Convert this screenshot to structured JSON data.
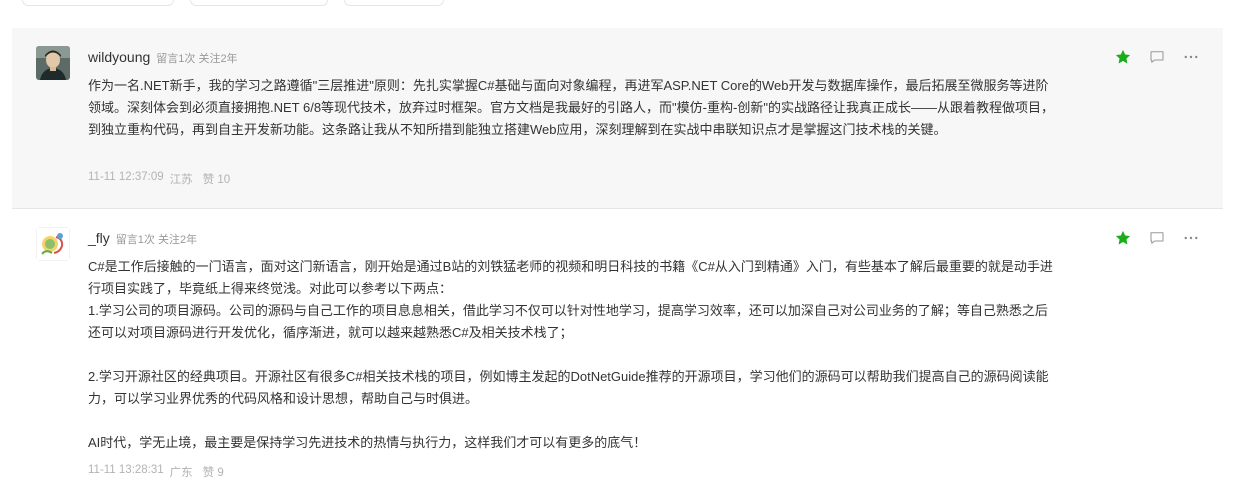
{
  "colors": {
    "accent": "#1aad19",
    "muted": "#999999",
    "card_bg": "#f7f7f7"
  },
  "comments": [
    {
      "username": "wildyoung",
      "stats": "留言1次 关注2年",
      "paragraphs": [
        "作为一名.NET新手，我的学习之路遵循\"三层推进\"原则：先扎实掌握C#基础与面向对象编程，再进军ASP.NET Core的Web开发与数据库操作，最后拓展至微服务等进阶领域。深刻体会到必须直接拥抱.NET 6/8等现代技术，放弃过时框架。官方文档是我最好的引路人，而\"模仿-重构-创新\"的实战路径让我真正成长——从跟着教程做项目，到独立重构代码，再到自主开发新功能。这条路让我从不知所措到能独立搭建Web应用，深刻理解到在实战中串联知识点才是掌握这门技术栈的关键。"
      ],
      "time": "11-11 12:37:09",
      "location": "江苏",
      "likes": "赞 10",
      "starred": true,
      "icons": [
        "star-icon",
        "comment-icon",
        "more-icon"
      ]
    },
    {
      "username": "_fly",
      "stats": "留言1次 关注2年",
      "paragraphs": [
        "C#是工作后接触的一门语言，面对这门新语言，刚开始是通过B站的刘铁猛老师的视频和明日科技的书籍《C#从入门到精通》入门，有些基本了解后最重要的就是动手进行项目实践了，毕竟纸上得来终觉浅。对此可以参考以下两点：\n1.学习公司的项目源码。公司的源码与自己工作的项目息息相关，借此学习不仅可以针对性地学习，提高学习效率，还可以加深自己对公司业务的了解；等自己熟悉之后还可以对项目源码进行开发优化，循序渐进，就可以越来越熟悉C#及相关技术栈了；",
        "2.学习开源社区的经典项目。开源社区有很多C#相关技术栈的项目，例如博主发起的DotNetGuide推荐的开源项目，学习他们的源码可以帮助我们提高自己的源码阅读能力，可以学习业界优秀的代码风格和设计思想，帮助自己与时俱进。",
        "AI时代，学无止境，最主要是保持学习先进技术的热情与执行力，这样我们才可以有更多的底气！"
      ],
      "time": "11-11 13:28:31",
      "location": "广东",
      "likes": "赞 9",
      "starred": true,
      "icons": [
        "star-icon",
        "comment-icon",
        "more-icon"
      ]
    }
  ]
}
